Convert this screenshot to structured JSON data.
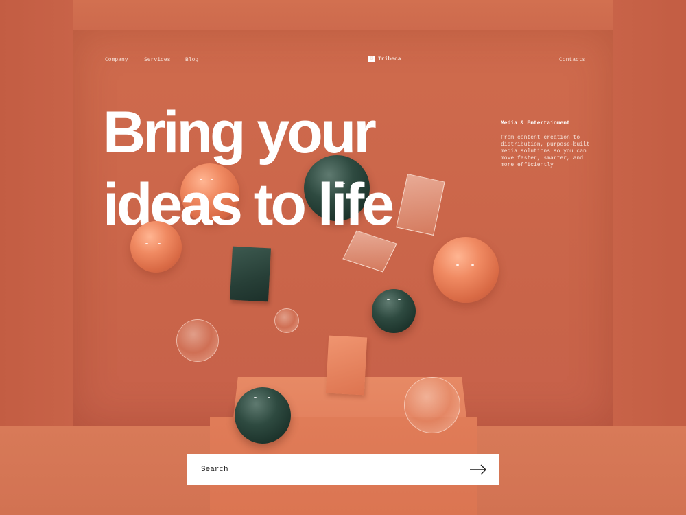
{
  "nav": {
    "links": [
      "Company",
      "Services",
      "Blog"
    ],
    "contacts": "Contacts"
  },
  "logo": {
    "mark": "B",
    "name": "Tribeca",
    "icon": "logo-mark-icon"
  },
  "hero": {
    "line1": "Bring your",
    "line2": "ideas to life"
  },
  "aside": {
    "title": "Media & Entertainment",
    "body": "From content creation to distribution, purpose-built media solutions so you can move faster, smarter, and more efficiently"
  },
  "search": {
    "placeholder": "Search",
    "icon": "arrow-right-icon"
  },
  "colors": {
    "background": "#c9664a",
    "text": "#ffffff",
    "accent_green": "#2e4a40",
    "accent_orange": "#f08a62"
  }
}
